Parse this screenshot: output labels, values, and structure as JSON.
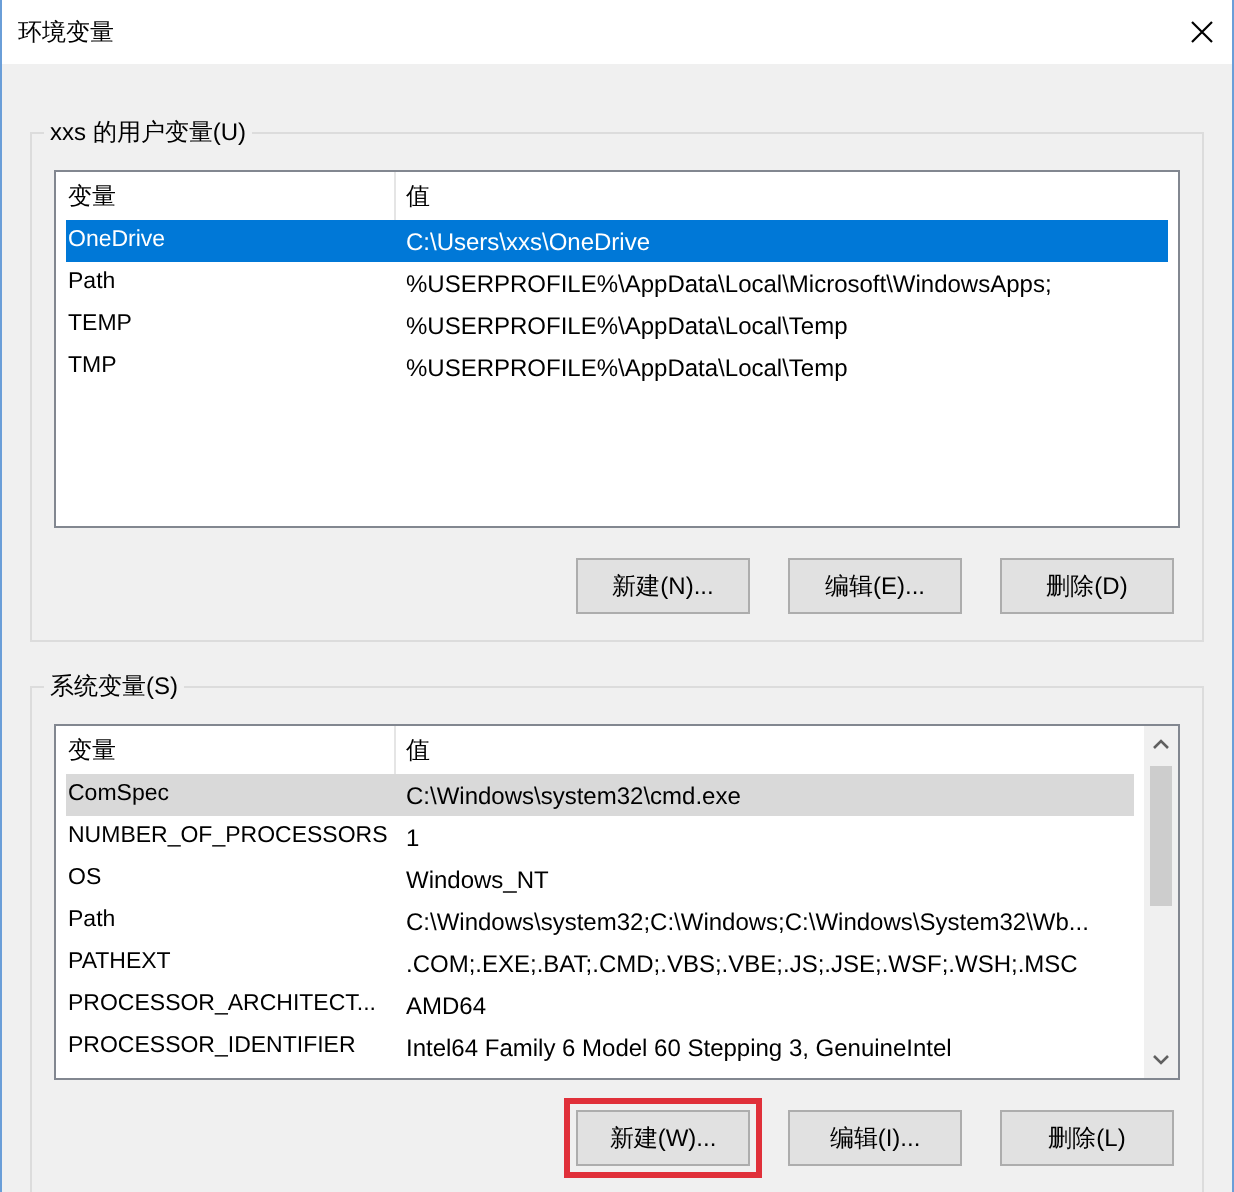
{
  "window": {
    "title": "环境变量"
  },
  "user_vars": {
    "label": "xxs 的用户变量(U)",
    "focused": true,
    "columns": [
      "变量",
      "值"
    ],
    "rows": [
      {
        "name": "OneDrive",
        "value": "C:\\Users\\xxs\\OneDrive",
        "selected": true
      },
      {
        "name": "Path",
        "value": "%USERPROFILE%\\AppData\\Local\\Microsoft\\WindowsApps;",
        "selected": false
      },
      {
        "name": "TEMP",
        "value": "%USERPROFILE%\\AppData\\Local\\Temp",
        "selected": false
      },
      {
        "name": "TMP",
        "value": "%USERPROFILE%\\AppData\\Local\\Temp",
        "selected": false
      }
    ],
    "buttons": [
      {
        "label": "新建(N)...",
        "highlighted": false
      },
      {
        "label": "编辑(E)...",
        "highlighted": false
      },
      {
        "label": "删除(D)",
        "highlighted": false
      }
    ]
  },
  "system_vars": {
    "label": "系统变量(S)",
    "focused": false,
    "columns": [
      "变量",
      "值"
    ],
    "rows": [
      {
        "name": "ComSpec",
        "value": "C:\\Windows\\system32\\cmd.exe",
        "selected": true
      },
      {
        "name": "NUMBER_OF_PROCESSORS",
        "value": "1",
        "selected": false
      },
      {
        "name": "OS",
        "value": "Windows_NT",
        "selected": false
      },
      {
        "name": "Path",
        "value": "C:\\Windows\\system32;C:\\Windows;C:\\Windows\\System32\\Wb...",
        "selected": false
      },
      {
        "name": "PATHEXT",
        "value": ".COM;.EXE;.BAT;.CMD;.VBS;.VBE;.JS;.JSE;.WSF;.WSH;.MSC",
        "selected": false
      },
      {
        "name": "PROCESSOR_ARCHITECT...",
        "value": "AMD64",
        "selected": false
      },
      {
        "name": "PROCESSOR_IDENTIFIER",
        "value": "Intel64 Family 6 Model 60 Stepping 3, GenuineIntel",
        "selected": false
      }
    ],
    "buttons": [
      {
        "label": "新建(W)...",
        "highlighted": true
      },
      {
        "label": "编辑(I)...",
        "highlighted": false
      },
      {
        "label": "删除(L)",
        "highlighted": false
      }
    ]
  }
}
